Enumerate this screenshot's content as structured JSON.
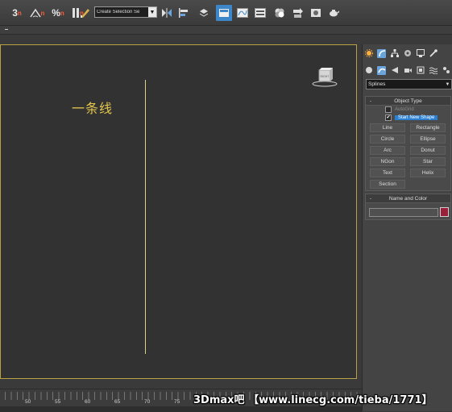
{
  "toolbar": {
    "snap3d": {
      "num": "3",
      "sub": "n"
    },
    "angle_snap": {
      "sub": "n"
    },
    "percent_snap": {
      "label": "%",
      "sub": "n"
    },
    "spinner_snap": {
      "sub": "n"
    },
    "selection_set_placeholder": "Create Selection Se"
  },
  "viewport": {
    "label": "一条线",
    "viewcube_label": "RIGHT",
    "accent_color": "#b8a244",
    "line_color": "#dcd28c"
  },
  "command_panel": {
    "category_dropdown": "Splines",
    "object_type_title": "Object Type",
    "autogrid_label": "AutoGrid",
    "start_new_shape_label": "Start New Shape",
    "start_new_shape_checked": "✔",
    "buttons": [
      "Line",
      "Rectangle",
      "Circle",
      "Ellipse",
      "Arc",
      "Donut",
      "NGon",
      "Star",
      "Text",
      "Helix",
      "Section"
    ],
    "name_color_title": "Name and Color",
    "object_color": "#9a1f3a",
    "minus": "-"
  },
  "timeline": {
    "ticks": [
      "50",
      "55",
      "60",
      "65",
      "70",
      "75"
    ]
  },
  "watermark": "3Dmax吧 【www.linecg.com/tieba/1771】"
}
